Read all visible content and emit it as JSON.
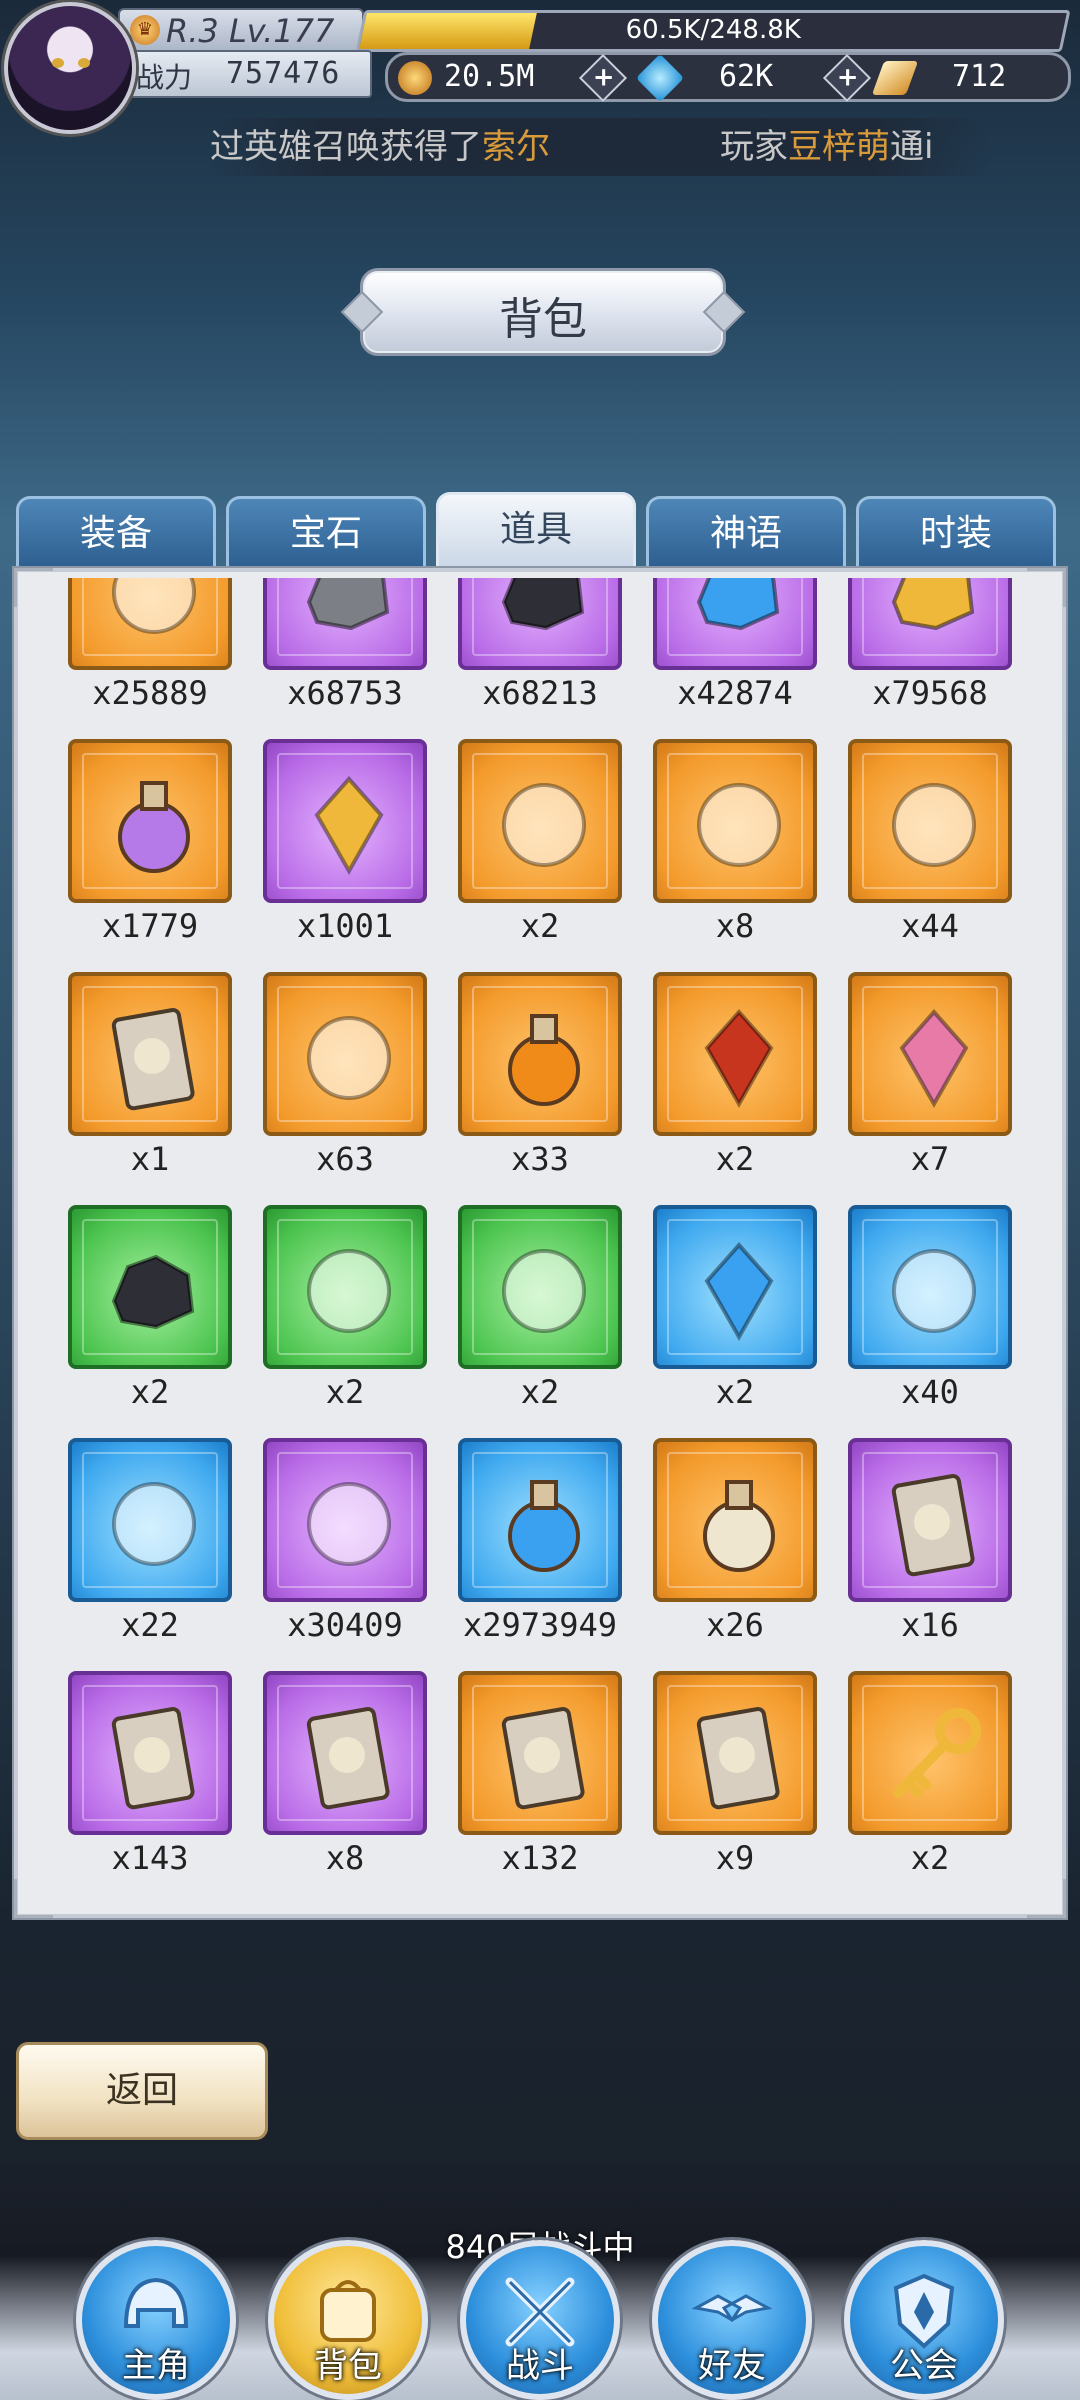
{
  "player": {
    "rank_level": "R.3 Lv.177",
    "exp_text": "60.5K/248.8K",
    "exp_progress": 0.243,
    "power_label": "战力",
    "power_value": "757476"
  },
  "resources": [
    {
      "icon": "gold-coin-icon",
      "value": "20.5M",
      "color": "#e6a33a"
    },
    {
      "icon": "blue-diamond-icon",
      "value": "62K",
      "color": "#2aa6e8"
    },
    {
      "icon": "gold-crystal-icon",
      "value": "712",
      "color": "#f1c16a"
    }
  ],
  "ticker": {
    "part1": "过英雄召唤获得了",
    "highlight1": "索尔",
    "part2": "玩家",
    "highlight2": "豆梓萌",
    "part3": "通i"
  },
  "title": "背包",
  "tabs": [
    {
      "label": "装备",
      "active": false
    },
    {
      "label": "宝石",
      "active": false
    },
    {
      "label": "道具",
      "active": true
    },
    {
      "label": "神语",
      "active": false
    },
    {
      "label": "时装",
      "active": false
    }
  ],
  "items": [
    {
      "icon": "bronze-medal-icon",
      "rarity": "orange",
      "count": "x25889"
    },
    {
      "icon": "grey-ore-icon",
      "rarity": "purple",
      "count": "x68753"
    },
    {
      "icon": "black-ore-icon",
      "rarity": "purple",
      "count": "x68213"
    },
    {
      "icon": "blue-ore-icon",
      "rarity": "purple",
      "count": "x42874"
    },
    {
      "icon": "gold-ore-icon",
      "rarity": "purple",
      "count": "x79568"
    },
    {
      "icon": "purple-potion-icon",
      "rarity": "orange",
      "count": "x1779"
    },
    {
      "icon": "amber-crystal-icon",
      "rarity": "purple",
      "count": "x1001"
    },
    {
      "icon": "blue-flame-icon",
      "rarity": "orange",
      "count": "x2"
    },
    {
      "icon": "scroll-icon",
      "rarity": "orange",
      "count": "x8"
    },
    {
      "icon": "anvil-icon",
      "rarity": "orange",
      "count": "x44"
    },
    {
      "icon": "hero-card-icon",
      "rarity": "orange",
      "count": "x1"
    },
    {
      "icon": "gold-sand-icon",
      "rarity": "orange",
      "count": "x63"
    },
    {
      "icon": "orange-potion-icon",
      "rarity": "orange",
      "count": "x33"
    },
    {
      "icon": "red-gem-icon",
      "rarity": "orange",
      "count": "x2"
    },
    {
      "icon": "rainbow-drop-icon",
      "rarity": "orange",
      "count": "x7"
    },
    {
      "icon": "dark-shard-icon",
      "rarity": "green",
      "count": "x2"
    },
    {
      "icon": "blue-scroll-icon",
      "rarity": "green",
      "count": "x2"
    },
    {
      "icon": "fire-leaf-icon",
      "rarity": "green",
      "count": "x2"
    },
    {
      "icon": "blue-crystal-icon",
      "rarity": "blue",
      "count": "x2"
    },
    {
      "icon": "skull-mask-icon",
      "rarity": "blue",
      "count": "x40"
    },
    {
      "icon": "shackle-icon",
      "rarity": "blue",
      "count": "x22"
    },
    {
      "icon": "rainbow-orb-icon",
      "rarity": "purple",
      "count": "x30409"
    },
    {
      "icon": "blue-potion-icon",
      "rarity": "blue",
      "count": "x2973949"
    },
    {
      "icon": "timer-potion-icon",
      "rarity": "orange",
      "count": "x26"
    },
    {
      "icon": "lion-card-icon",
      "rarity": "purple",
      "count": "x16"
    },
    {
      "icon": "cross-card-icon",
      "rarity": "purple",
      "count": "x143"
    },
    {
      "icon": "warrior-card-icon",
      "rarity": "purple",
      "count": "x8"
    },
    {
      "icon": "star-card-icon",
      "rarity": "orange",
      "count": "x132"
    },
    {
      "icon": "card-stack-icon",
      "rarity": "orange",
      "count": "x9"
    },
    {
      "icon": "gold-key-icon",
      "rarity": "orange",
      "count": "x2"
    }
  ],
  "back_label": "返回",
  "battle_status": "840层战斗中",
  "nav": [
    {
      "label": "主角",
      "icon": "helmet-icon",
      "active": false
    },
    {
      "label": "背包",
      "icon": "backpack-icon",
      "active": true
    },
    {
      "label": "战斗",
      "icon": "crossed-swords-icon",
      "active": false
    },
    {
      "label": "好友",
      "icon": "handshake-icon",
      "active": false
    },
    {
      "label": "公会",
      "icon": "guild-crest-icon",
      "active": false
    }
  ]
}
